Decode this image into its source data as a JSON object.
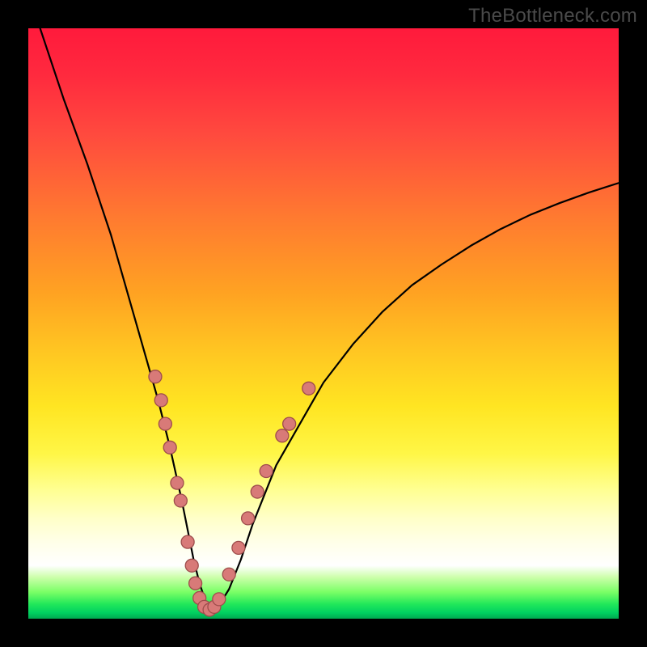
{
  "watermark": "TheBottleneck.com",
  "chart_data": {
    "type": "line",
    "title": "",
    "xlabel": "",
    "ylabel": "",
    "xlim": [
      0,
      100
    ],
    "ylim": [
      0,
      100
    ],
    "grid": false,
    "legend": false,
    "series": [
      {
        "name": "curve",
        "x": [
          2,
          4,
          6,
          8,
          10,
          12,
          14,
          16,
          18,
          20,
          22,
          24,
          26,
          27,
          28,
          29,
          30,
          31,
          32,
          34,
          36,
          38,
          42,
          46,
          50,
          55,
          60,
          65,
          70,
          75,
          80,
          85,
          90,
          95,
          100
        ],
        "y": [
          100,
          94,
          88,
          82.5,
          77,
          71,
          65,
          58,
          51,
          44,
          37,
          29,
          20,
          15,
          10,
          6,
          3,
          1.5,
          1.8,
          5,
          10,
          16,
          26,
          33,
          40,
          46.5,
          52,
          56.5,
          60,
          63.2,
          66,
          68.4,
          70.4,
          72.2,
          73.8
        ]
      }
    ],
    "beads": [
      {
        "x": 21.5,
        "y": 41
      },
      {
        "x": 22.5,
        "y": 37
      },
      {
        "x": 23.2,
        "y": 33
      },
      {
        "x": 24.0,
        "y": 29
      },
      {
        "x": 25.2,
        "y": 23
      },
      {
        "x": 25.8,
        "y": 20
      },
      {
        "x": 27.0,
        "y": 13
      },
      {
        "x": 27.7,
        "y": 9
      },
      {
        "x": 28.3,
        "y": 6
      },
      {
        "x": 29.0,
        "y": 3.5
      },
      {
        "x": 29.8,
        "y": 2
      },
      {
        "x": 30.7,
        "y": 1.5
      },
      {
        "x": 31.5,
        "y": 2
      },
      {
        "x": 32.3,
        "y": 3.3
      },
      {
        "x": 34.0,
        "y": 7.5
      },
      {
        "x": 35.6,
        "y": 12
      },
      {
        "x": 37.2,
        "y": 17
      },
      {
        "x": 38.8,
        "y": 21.5
      },
      {
        "x": 40.3,
        "y": 25
      },
      {
        "x": 43.0,
        "y": 31
      },
      {
        "x": 44.2,
        "y": 33
      },
      {
        "x": 47.5,
        "y": 39
      }
    ],
    "bead_radius_px": 8
  }
}
